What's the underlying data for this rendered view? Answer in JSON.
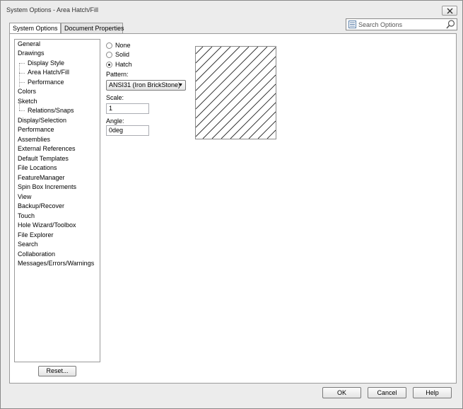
{
  "window": {
    "title": "System Options - Area Hatch/Fill"
  },
  "tabs": [
    {
      "label": "System Options",
      "active": true
    },
    {
      "label": "Document Properties",
      "active": false
    }
  ],
  "search": {
    "placeholder": "Search Options",
    "icon": "search-icon"
  },
  "tree": [
    {
      "label": "General",
      "level": 0
    },
    {
      "label": "Drawings",
      "level": 0
    },
    {
      "label": "Display Style",
      "level": 1
    },
    {
      "label": "Area Hatch/Fill",
      "level": 1,
      "selected": true
    },
    {
      "label": "Performance",
      "level": 1
    },
    {
      "label": "Colors",
      "level": 0
    },
    {
      "label": "Sketch",
      "level": 0
    },
    {
      "label": "Relations/Snaps",
      "level": 1
    },
    {
      "label": "Display/Selection",
      "level": 0
    },
    {
      "label": "Performance",
      "level": 0
    },
    {
      "label": "Assemblies",
      "level": 0
    },
    {
      "label": "External References",
      "level": 0
    },
    {
      "label": "Default Templates",
      "level": 0
    },
    {
      "label": "File Locations",
      "level": 0
    },
    {
      "label": "FeatureManager",
      "level": 0
    },
    {
      "label": "Spin Box Increments",
      "level": 0
    },
    {
      "label": "View",
      "level": 0
    },
    {
      "label": "Backup/Recover",
      "level": 0
    },
    {
      "label": "Touch",
      "level": 0
    },
    {
      "label": "Hole Wizard/Toolbox",
      "level": 0
    },
    {
      "label": "File Explorer",
      "level": 0
    },
    {
      "label": "Search",
      "level": 0
    },
    {
      "label": "Collaboration",
      "level": 0
    },
    {
      "label": "Messages/Errors/Warnings",
      "level": 0
    }
  ],
  "reset_label": "Reset...",
  "fill": {
    "options": [
      {
        "label": "None",
        "checked": false
      },
      {
        "label": "Solid",
        "checked": false
      },
      {
        "label": "Hatch",
        "checked": true
      }
    ],
    "pattern_label": "Pattern:",
    "pattern_value": "ANSI31 (Iron BrickStone)",
    "scale_label": "Scale:",
    "scale_value": "1",
    "angle_label": "Angle:",
    "angle_value": "0deg"
  },
  "footer": {
    "ok": "OK",
    "cancel": "Cancel",
    "help": "Help"
  }
}
